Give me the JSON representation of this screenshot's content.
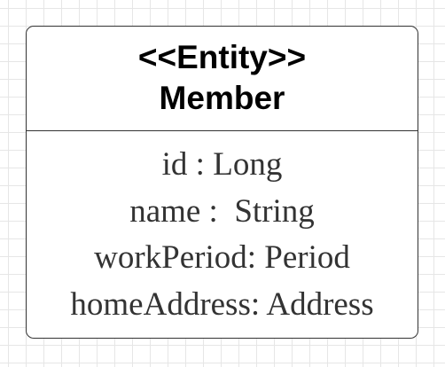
{
  "entity": {
    "stereotype": "<<Entity>>",
    "name": "Member"
  },
  "attributes": [
    "id : Long",
    "name :  String",
    "workPeriod: Period",
    "homeAddress: Address"
  ],
  "colors": {
    "border": "#333333",
    "grid": "#e6e6e6",
    "attribute_text": "#333333",
    "title_text": "#000000"
  }
}
